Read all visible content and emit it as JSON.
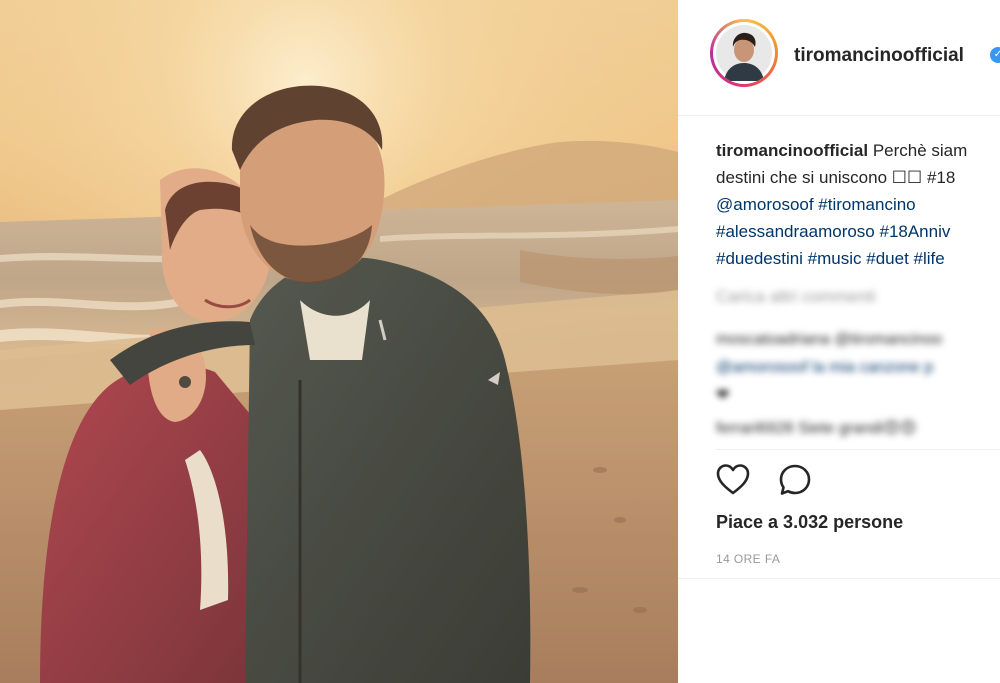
{
  "post": {
    "username": "tiromancinoofficial",
    "verified_mark": "✓",
    "caption": {
      "username": "tiromancinoofficial",
      "line1": "Perchè siam",
      "line2": "destini che si uniscono ☐☐ #18",
      "line3": "@amorosoof #tiromancino",
      "line4": "#alessandraamoroso #18Anniv",
      "line5": "#duedestini #music #duet #life"
    },
    "load_more": "Carica altri commenti",
    "comments": [
      {
        "line1": "moscatoadriana @tiromancinoo",
        "line2": "@amorosoof la mia canzone p",
        "line3": "❤"
      },
      {
        "line1": "ferrari6928 Siete grandi😍😍"
      }
    ],
    "likes_text": "Piace a 3.032 persone",
    "time_ago": "14 ORE FA"
  },
  "icons": {
    "like": "heart-outline-icon",
    "comment": "speech-bubble-icon",
    "verified": "verified-badge-icon"
  },
  "colors": {
    "text": "#262626",
    "muted": "#999999",
    "link": "#003569",
    "verified": "#3897f0",
    "divider": "#efefef"
  }
}
